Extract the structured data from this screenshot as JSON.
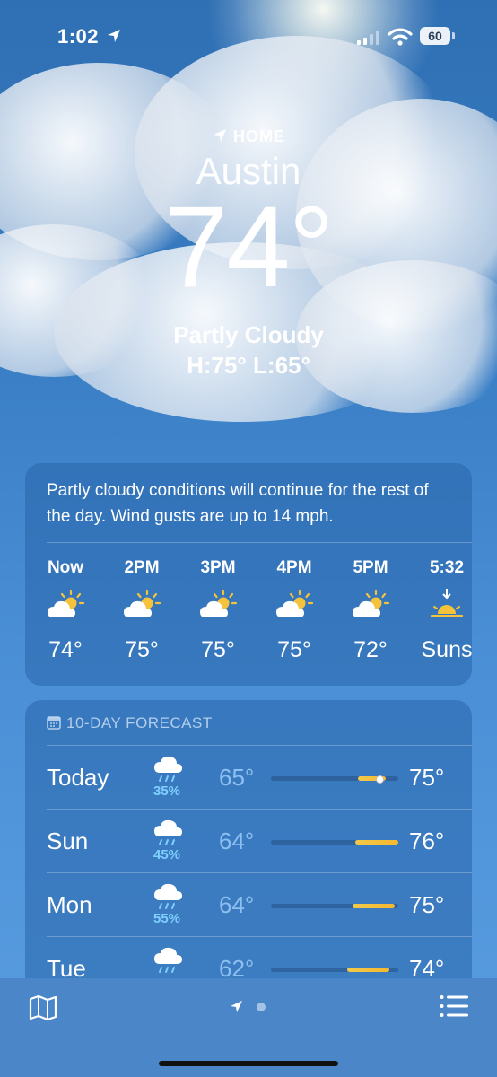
{
  "status": {
    "time": "1:02",
    "battery": "60"
  },
  "header": {
    "home_label": "HOME",
    "city": "Austin",
    "temp": "74°",
    "condition": "Partly Cloudy",
    "hilo": "H:75°  L:65°"
  },
  "hourly": {
    "summary": "Partly cloudy conditions will continue for the rest of the day. Wind gusts are up to 14 mph.",
    "hours": [
      {
        "label": "Now",
        "icon": "partly-cloudy-icon",
        "temp": "74°"
      },
      {
        "label": "2PM",
        "icon": "partly-cloudy-icon",
        "temp": "75°"
      },
      {
        "label": "3PM",
        "icon": "partly-cloudy-icon",
        "temp": "75°"
      },
      {
        "label": "4PM",
        "icon": "partly-cloudy-icon",
        "temp": "75°"
      },
      {
        "label": "5PM",
        "icon": "partly-cloudy-icon",
        "temp": "72°"
      },
      {
        "label": "5:32",
        "icon": "sunset-icon",
        "temp": "Suns"
      }
    ]
  },
  "tenday": {
    "title": "10-DAY FORECAST",
    "days": [
      {
        "day": "Today",
        "precip": "35%",
        "low": "65°",
        "high": "75°",
        "range_start": 0.68,
        "range_end": 0.9
      },
      {
        "day": "Sun",
        "precip": "45%",
        "low": "64°",
        "high": "76°",
        "range_start": 0.66,
        "range_end": 1.0
      },
      {
        "day": "Mon",
        "precip": "55%",
        "low": "64°",
        "high": "75°",
        "range_start": 0.64,
        "range_end": 0.97
      },
      {
        "day": "Tue",
        "precip": "",
        "low": "62°",
        "high": "74°",
        "range_start": 0.6,
        "range_end": 0.93
      }
    ]
  },
  "colors": {
    "accent": "#f5b82e",
    "precip": "#7fd0ff"
  }
}
